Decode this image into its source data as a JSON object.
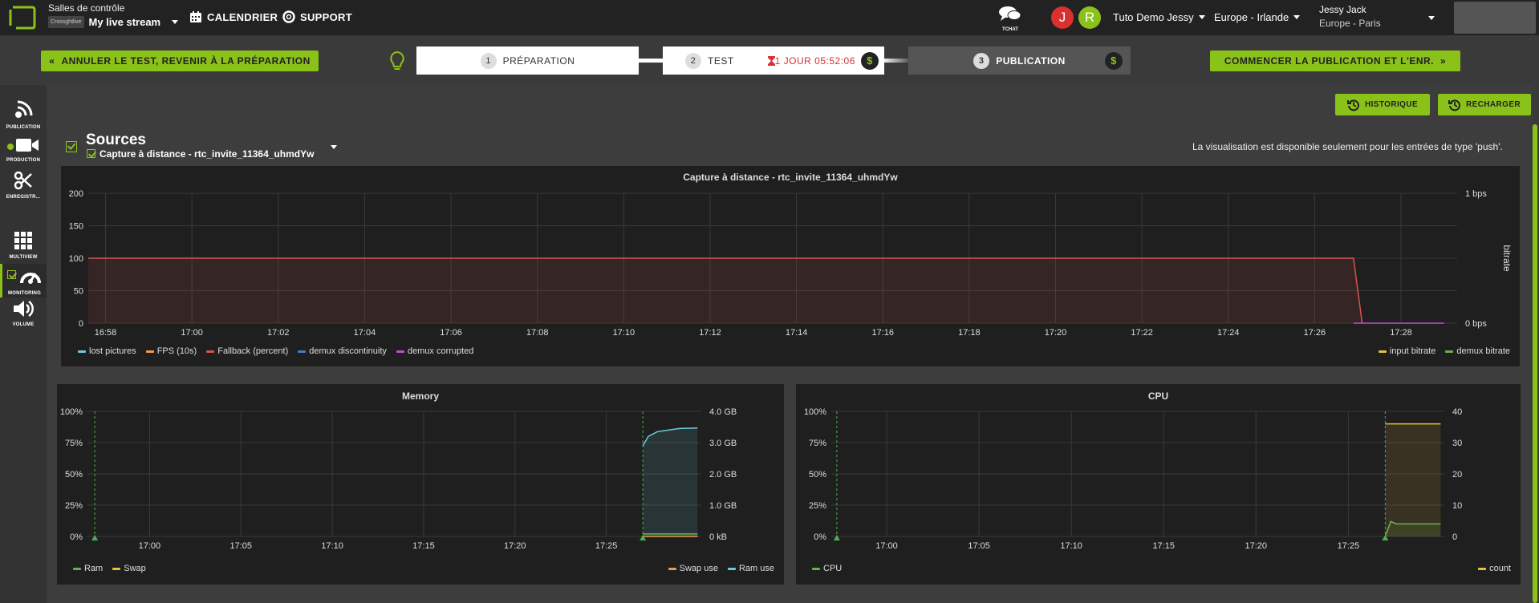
{
  "header": {
    "control_room_label": "Salles de contrôle",
    "brand_badge": "Crossghtlive",
    "stream_name": "My live stream",
    "calendar_label": "CALENDRIER",
    "support_label": "SUPPORT",
    "chat_label": "TCHAT",
    "avatar1": "J",
    "avatar2": "R",
    "account_name": "Tuto Demo Jessy",
    "region": "Europe - Irlande",
    "user_name": "Jessy Jack",
    "user_tz": "Europe - Paris"
  },
  "workflow": {
    "cancel_label": "ANNULER LE TEST, REVENIR À LA PRÉPARATION",
    "steps": [
      {
        "num": "1",
        "label": "PRÉPARATION"
      },
      {
        "num": "2",
        "label": "TEST",
        "timer": "1 JOUR 05:52:06"
      },
      {
        "num": "3",
        "label": "PUBLICATION"
      }
    ],
    "dollar": "$",
    "start_label": "COMMENCER LA PUBLICATION ET L'ENR."
  },
  "sidebar": [
    {
      "label": "PUBLICATION",
      "icon": "publication-icon"
    },
    {
      "label": "PRODUCTION",
      "icon": "camera-icon"
    },
    {
      "label": "ENREGISTR...",
      "icon": "scissors-icon"
    },
    {
      "label": "MULTIVIEW",
      "icon": "grid-icon"
    },
    {
      "label": "MONITORING",
      "icon": "gauge-icon"
    },
    {
      "label": "VOLUME",
      "icon": "speaker-icon"
    }
  ],
  "toolbar": {
    "history_label": "HISTORIQUE",
    "reload_label": "RECHARGER"
  },
  "sources": {
    "title": "Sources",
    "selected": "Capture à distance - rtc_invite_11364_uhmdYw",
    "note": "La visualisation est disponible seulement pour les entrées de type 'push'."
  },
  "colors": {
    "accent": "#8bc21a",
    "red": "#d9534f",
    "orange": "#f2994a",
    "cyan": "#6ccde0",
    "blue": "#3b82c4",
    "magenta": "#c04fd0",
    "yellow": "#e8c13a",
    "green": "#6ab04c"
  },
  "chart_data": [
    {
      "type": "line",
      "title": "Capture à distance - rtc_invite_11364_uhmdYw",
      "x_ticks": [
        "16:58",
        "17:00",
        "17:02",
        "17:04",
        "17:06",
        "17:08",
        "17:10",
        "17:12",
        "17:14",
        "17:16",
        "17:18",
        "17:20",
        "17:22",
        "17:24",
        "17:26",
        "17:28"
      ],
      "y_left_ticks": [
        "0",
        "50",
        "100",
        "150",
        "200"
      ],
      "ylim_left": [
        0,
        200
      ],
      "y_right_ticks": [
        "0 bps",
        "1 bps"
      ],
      "y_right_label": "bitrate",
      "series": [
        {
          "name": "lost pictures",
          "color": "#6ccde0",
          "axis": "left"
        },
        {
          "name": "FPS (10s)",
          "color": "#f2994a",
          "axis": "left"
        },
        {
          "name": "Fallback (percent)",
          "color": "#d9534f",
          "axis": "left",
          "points": [
            [
              "16:57.6",
              100
            ],
            [
              "17:26.9",
              100
            ],
            [
              "17:27.1",
              0
            ]
          ]
        },
        {
          "name": "demux discontinuity",
          "color": "#3b82c4",
          "axis": "left"
        },
        {
          "name": "demux corrupted",
          "color": "#c04fd0",
          "axis": "left",
          "points": [
            [
              "17:26.9",
              0
            ],
            [
              "17:29",
              0
            ]
          ]
        },
        {
          "name": "input bitrate",
          "color": "#e8c13a",
          "axis": "right"
        },
        {
          "name": "demux bitrate",
          "color": "#6ab04c",
          "axis": "right"
        }
      ]
    },
    {
      "type": "area",
      "title": "Memory",
      "x_ticks": [
        "17:00",
        "17:05",
        "17:10",
        "17:15",
        "17:20",
        "17:25"
      ],
      "y_left_ticks": [
        "0%",
        "25%",
        "50%",
        "75%",
        "100%"
      ],
      "y_right_ticks": [
        "0 kB",
        "1.0 GB",
        "2.0 GB",
        "3.0 GB",
        "4.0 GB"
      ],
      "series": [
        {
          "name": "Ram",
          "color": "#6ab04c",
          "axis": "left",
          "points": [
            [
              "17:27",
              2
            ],
            [
              "17:30",
              2
            ]
          ]
        },
        {
          "name": "Swap",
          "color": "#e8c13a",
          "axis": "left"
        },
        {
          "name": "Swap use",
          "color": "#f2994a",
          "axis": "right",
          "points": [
            [
              "17:27",
              0
            ],
            [
              "17:30",
              0
            ]
          ]
        },
        {
          "name": "Ram use",
          "color": "#6ccde0",
          "axis": "right",
          "points": [
            [
              "17:27",
              2.9
            ],
            [
              "17:27.3",
              3.2
            ],
            [
              "17:27.8",
              3.35
            ],
            [
              "17:29",
              3.45
            ],
            [
              "17:30",
              3.47
            ]
          ]
        }
      ]
    },
    {
      "type": "area",
      "title": "CPU",
      "x_ticks": [
        "17:00",
        "17:05",
        "17:10",
        "17:15",
        "17:20",
        "17:25"
      ],
      "y_left_ticks": [
        "0%",
        "25%",
        "50%",
        "75%",
        "100%"
      ],
      "y_right_ticks": [
        "0",
        "10",
        "20",
        "30",
        "40"
      ],
      "series": [
        {
          "name": "CPU",
          "color": "#6ab04c",
          "axis": "left",
          "points": [
            [
              "17:27",
              0
            ],
            [
              "17:27.3",
              12
            ],
            [
              "17:27.6",
              10
            ],
            [
              "17:30",
              10
            ]
          ]
        },
        {
          "name": "count",
          "color": "#e8c13a",
          "axis": "right",
          "points": [
            [
              "17:27",
              36
            ],
            [
              "17:30",
              36
            ]
          ]
        }
      ]
    }
  ]
}
